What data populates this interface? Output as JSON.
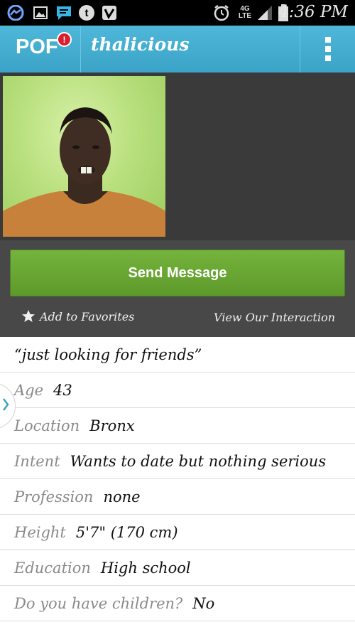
{
  "status_bar": {
    "time": "4:36 PM",
    "icons": [
      "messenger-icon",
      "image-icon",
      "chat-icon",
      "tumblr-icon",
      "vine-icon",
      "alarm-icon",
      "lte-icon",
      "signal-icon",
      "battery-icon"
    ],
    "network": "4G"
  },
  "header": {
    "logo": "POF",
    "badge": "!",
    "username": "thalicious"
  },
  "actions": {
    "send_message": "Send Message",
    "add_favorites": "Add to Favorites",
    "view_interaction": "View Our Interaction"
  },
  "profile": {
    "headline": "“just looking for friends”",
    "fields": [
      {
        "label": "Age",
        "value": "43"
      },
      {
        "label": "Location",
        "value": "Bronx"
      },
      {
        "label": "Intent",
        "value": "Wants to date but nothing serious"
      },
      {
        "label": "Profession",
        "value": "none"
      },
      {
        "label": "Height",
        "value": "5'7\" (170 cm)"
      },
      {
        "label": "Education",
        "value": "High school"
      },
      {
        "label": "Do you have children?",
        "value": "No"
      }
    ]
  },
  "colors": {
    "header": "#3aa3c7",
    "send_button": "#6aa834",
    "badge": "#d9202f"
  }
}
